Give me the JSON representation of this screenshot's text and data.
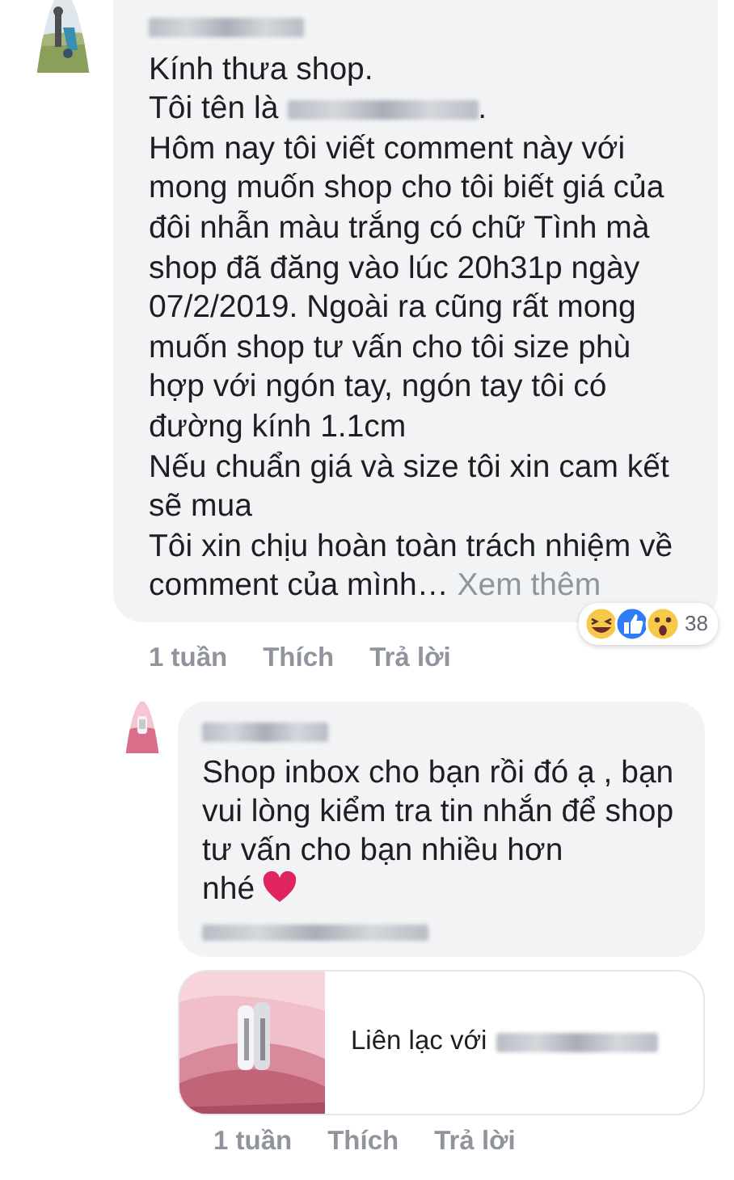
{
  "comments": [
    {
      "paragraphs": [
        {
          "kind": "plain",
          "text": "Kính thưa shop."
        },
        {
          "kind": "redacted",
          "before": "Tôi tên là",
          "after": "."
        },
        {
          "kind": "plain",
          "text": "Hôm nay tôi viết comment này với mong muốn shop cho tôi biết giá của đôi nhẫn màu trắng có chữ Tình mà shop đã đăng vào lúc 20h31p ngày 07/2/2019. Ngoài ra cũng rất mong muốn shop tư vấn cho tôi size phù hợp với ngón tay, ngón tay tôi có đường kính 1.1cm"
        },
        {
          "kind": "plain",
          "text": "Nếu chuẩn giá và size tôi xin cam kết sẽ mua"
        },
        {
          "kind": "more",
          "text": "Tôi xin chịu hoàn toàn trách nhiệm về comment của mình…",
          "link": "Xem thêm"
        }
      ],
      "time": "1 tuần",
      "like": "Thích",
      "reply": "Trả lời",
      "reactions": {
        "items": [
          {
            "kind": "haha"
          },
          {
            "kind": "like"
          },
          {
            "kind": "wow"
          }
        ],
        "count": "38"
      }
    },
    {
      "reply_level": true,
      "paragraphs": [
        {
          "kind": "heart",
          "text": "Shop inbox cho bạn rồi đó ạ , bạn vui lòng kiểm tra tin nhắn để shop tư vấn cho bạn nhiều hơn",
          "tail": "nhé"
        },
        {
          "kind": "redacted-link"
        }
      ],
      "preview": {
        "kind": "picture",
        "before": "Liên lạc với"
      },
      "time": "1 tuần",
      "like": "Thích",
      "reply": "Trả lời"
    }
  ]
}
